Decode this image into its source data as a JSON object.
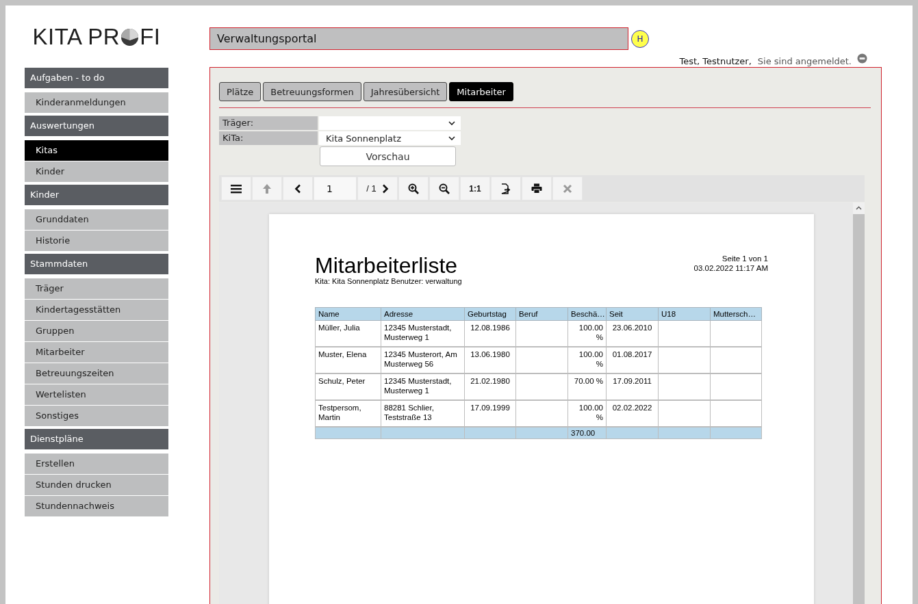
{
  "logo": {
    "text_before": "KITA PR",
    "text_after": "FI"
  },
  "sidebar": {
    "sections": [
      {
        "title": "Aufgaben - to do",
        "items": [
          {
            "label": "Kinderanmeldungen",
            "selected": false
          }
        ]
      },
      {
        "title": "Auswertungen",
        "items": [
          {
            "label": "Kitas",
            "selected": true
          },
          {
            "label": "Kinder",
            "selected": false
          }
        ]
      },
      {
        "title": "Kinder",
        "items": [
          {
            "label": "Grunddaten",
            "selected": false
          },
          {
            "label": "Historie",
            "selected": false
          }
        ]
      },
      {
        "title": "Stammdaten",
        "items": [
          {
            "label": "Träger",
            "selected": false
          },
          {
            "label": "Kindertagesstätten",
            "selected": false
          },
          {
            "label": "Gruppen",
            "selected": false
          },
          {
            "label": "Mitarbeiter",
            "selected": false
          },
          {
            "label": "Betreuungszeiten",
            "selected": false
          },
          {
            "label": "Wertelisten",
            "selected": false
          },
          {
            "label": "Sonstiges",
            "selected": false
          }
        ]
      },
      {
        "title": "Dienstpläne",
        "items": [
          {
            "label": "Erstellen",
            "selected": false
          },
          {
            "label": "Stunden drucken",
            "selected": false
          },
          {
            "label": "Stundennachweis",
            "selected": false
          }
        ]
      }
    ]
  },
  "header": {
    "title": "Verwaltungsportal",
    "help_badge": "H"
  },
  "user": {
    "name": "Test, Testnutzer,",
    "status": "Sie sind angemeldet."
  },
  "tabs": [
    {
      "label": "Plätze",
      "selected": false
    },
    {
      "label": "Betreuungsformen",
      "selected": false
    },
    {
      "label": "Jahresübersicht",
      "selected": false
    },
    {
      "label": "Mitarbeiter",
      "selected": true
    }
  ],
  "filters": [
    {
      "label": "Träger:"
    },
    {
      "label": "KiTa:",
      "value": "Kita Sonnenplatz"
    }
  ],
  "preview_button": "Vorschau",
  "viewer": {
    "toolbar": [
      {
        "kind": "menu",
        "disabled": false
      },
      {
        "kind": "up",
        "disabled": true
      },
      {
        "kind": "prev",
        "disabled": false
      },
      {
        "kind": "page",
        "value": "1"
      },
      {
        "kind": "count",
        "text": "/ 1",
        "disabled": false
      },
      {
        "kind": "zoom_in",
        "disabled": false
      },
      {
        "kind": "zoom_out",
        "disabled": false
      },
      {
        "kind": "actual_size",
        "text": "1:1",
        "disabled": false
      },
      {
        "kind": "export",
        "disabled": false
      },
      {
        "kind": "print",
        "disabled": false
      },
      {
        "kind": "close",
        "disabled": true
      }
    ]
  },
  "report": {
    "title": "Mitarbeiterliste",
    "subtitle": "Kita: Kita Sonnenplatz Benutzer: verwaltung",
    "page_info": "Seite 1 von 1",
    "timestamp": "03.02.2022 11:17 AM",
    "columns": [
      {
        "label": "Name"
      },
      {
        "label": "Adresse"
      },
      {
        "label": "Geburtstag"
      },
      {
        "label": "Beruf"
      },
      {
        "label": "Beschä…",
        "total": "370.00"
      },
      {
        "label": "Seit"
      },
      {
        "label": "U18"
      },
      {
        "label": "Muttersch…"
      }
    ],
    "rows": [
      [
        "Müller, Julia",
        "12345 Musterstadt, Musterweg 1",
        "12.08.1986",
        null,
        "100.00 %",
        "23.06.2010",
        null,
        null
      ],
      [
        "Muster, Elena",
        "12345 Musterort, Am Musterweg 56",
        "13.06.1980",
        null,
        "100.00 %",
        "01.08.2017",
        null,
        null
      ],
      [
        "Schulz, Peter",
        "12345 Musterstadt, Musterweg 1",
        "21.02.1980",
        null,
        "70.00 %",
        "17.09.2011",
        null,
        null
      ],
      [
        "Testpersom, Martin",
        "88281 Schlier, Teststraße 13",
        "17.09.1999",
        null,
        "100.00 %",
        "02.02.2022",
        null,
        null
      ]
    ]
  }
}
